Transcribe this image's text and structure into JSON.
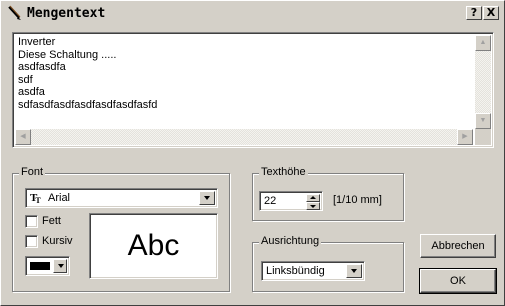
{
  "window": {
    "title": "Mengentext",
    "help_label": "?",
    "close_label": "X"
  },
  "text_area": {
    "lines": [
      "Inverter",
      "Diese Schaltung .....",
      "asdfasdfa",
      "sdf",
      "asdfa",
      "sdfasdfasdfasdfasdfasdfasfd"
    ]
  },
  "font_group": {
    "label": "Font",
    "font_value": "Arial",
    "font_icon": "truetype-icon",
    "bold_label": "Fett",
    "bold_checked": false,
    "italic_label": "Kursiv",
    "italic_checked": false,
    "color_value": "#000000",
    "preview_text": "Abc"
  },
  "height_group": {
    "label": "Texthöhe",
    "value": "22",
    "unit": "[1/10 mm]"
  },
  "align_group": {
    "label": "Ausrichtung",
    "value": "Linksbündig"
  },
  "buttons": {
    "cancel_label": "Abbrechen",
    "ok_label": "OK"
  }
}
